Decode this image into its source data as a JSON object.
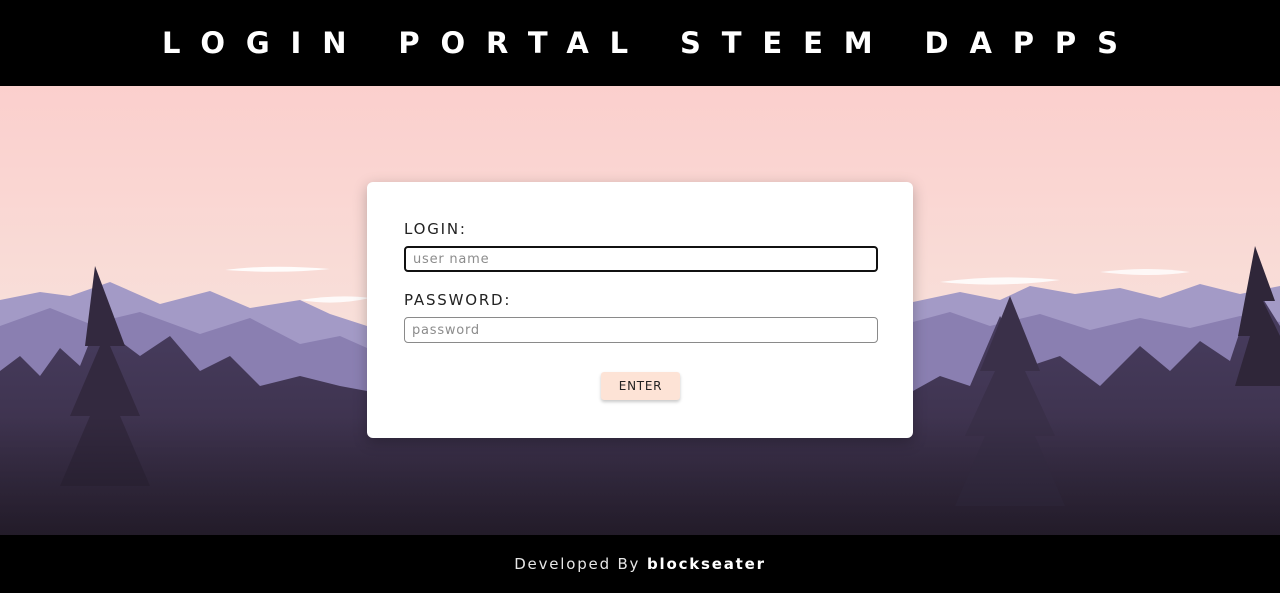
{
  "header": {
    "title": "LOGIN PORTAL STEEM DAPPS"
  },
  "login_form": {
    "login_label": "LOGIN:",
    "username_placeholder": "user name",
    "password_label": "PASSWORD:",
    "password_placeholder": "password",
    "enter_label": "ENTER"
  },
  "footer": {
    "prefix": "Developed By",
    "author": "blockseater"
  },
  "colors": {
    "bar_background": "#000000",
    "sky_top": "#fbd1cf",
    "sky_bottom": "#f7e4dd",
    "mountains": "#8f84b4",
    "forest_dark": "#3c324c",
    "enter_button": "#fde3d6"
  }
}
